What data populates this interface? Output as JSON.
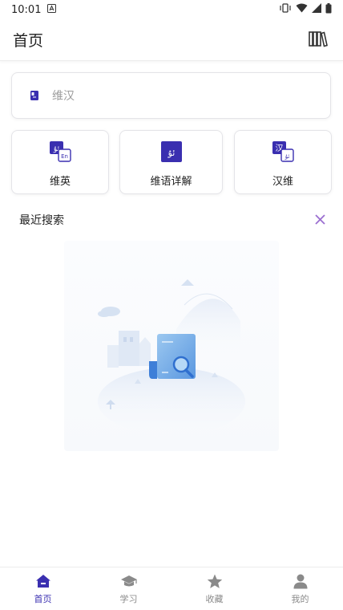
{
  "status_bar": {
    "time": "10:01"
  },
  "header": {
    "title": "首页"
  },
  "search": {
    "placeholder": "维汉"
  },
  "cards": [
    {
      "label": "维英",
      "icon": "uyghur-english-icon"
    },
    {
      "label": "维语详解",
      "icon": "uyghur-detail-icon"
    },
    {
      "label": "汉维",
      "icon": "chinese-uyghur-icon"
    }
  ],
  "card_glyphs": {
    "uyghur": "ئۇ",
    "english": "En",
    "chinese": "汉"
  },
  "recent": {
    "title": "最近搜索"
  },
  "bottom_nav": [
    {
      "label": "首页",
      "icon": "home-icon",
      "active": true
    },
    {
      "label": "学习",
      "icon": "graduation-cap-icon",
      "active": false
    },
    {
      "label": "收藏",
      "icon": "star-icon",
      "active": false
    },
    {
      "label": "我的",
      "icon": "person-icon",
      "active": false
    }
  ],
  "colors": {
    "accent": "#3a2fb0",
    "icon_gray": "#8a8a8a",
    "clear": "#9b6fd0"
  }
}
